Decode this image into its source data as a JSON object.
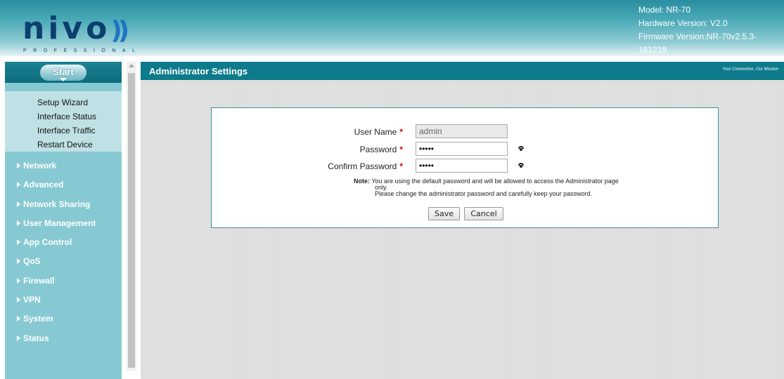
{
  "header": {
    "logo_text": "nivo",
    "logo_sub": "PROFESSIONAL",
    "model": "Model: NR-70",
    "hardware_version": "Hardware Version: V2.0",
    "firmware_version": "Firmware Version:NR-70v2.5.3-161219"
  },
  "sidebar": {
    "start_label": "Start",
    "sub_items": [
      "Setup Wizard",
      "Interface Status",
      "Interface Traffic",
      "Restart Device"
    ],
    "nav_items": [
      "Network",
      "Advanced",
      "Network Sharing",
      "User Management",
      "App Control",
      "QoS",
      "Firewall",
      "VPN",
      "System",
      "Status"
    ]
  },
  "page": {
    "title": "Administrator Settings",
    "slogan": "Your Connection, Our Mission"
  },
  "form": {
    "user_name_label": "User Name",
    "user_name_value": "admin",
    "password_label": "Password",
    "password_value": "•••••",
    "confirm_label": "Confirm Password",
    "confirm_value": "•••••",
    "required_mark": "*",
    "note_label": "Note:",
    "note_line1": "You are using the default password and will be allowed to access the Administrator page",
    "note_line2": "only.",
    "note_line3": "Please change the administrator password and carefully keep your password.",
    "save_label": "Save",
    "cancel_label": "Cancel"
  },
  "colors": {
    "header_teal": "#2a8ea0",
    "title_bar": "#0d7b8b",
    "sidebar_bg": "#86c9d2",
    "logo_navy": "#0b3f6e",
    "required_red": "#d40000"
  }
}
